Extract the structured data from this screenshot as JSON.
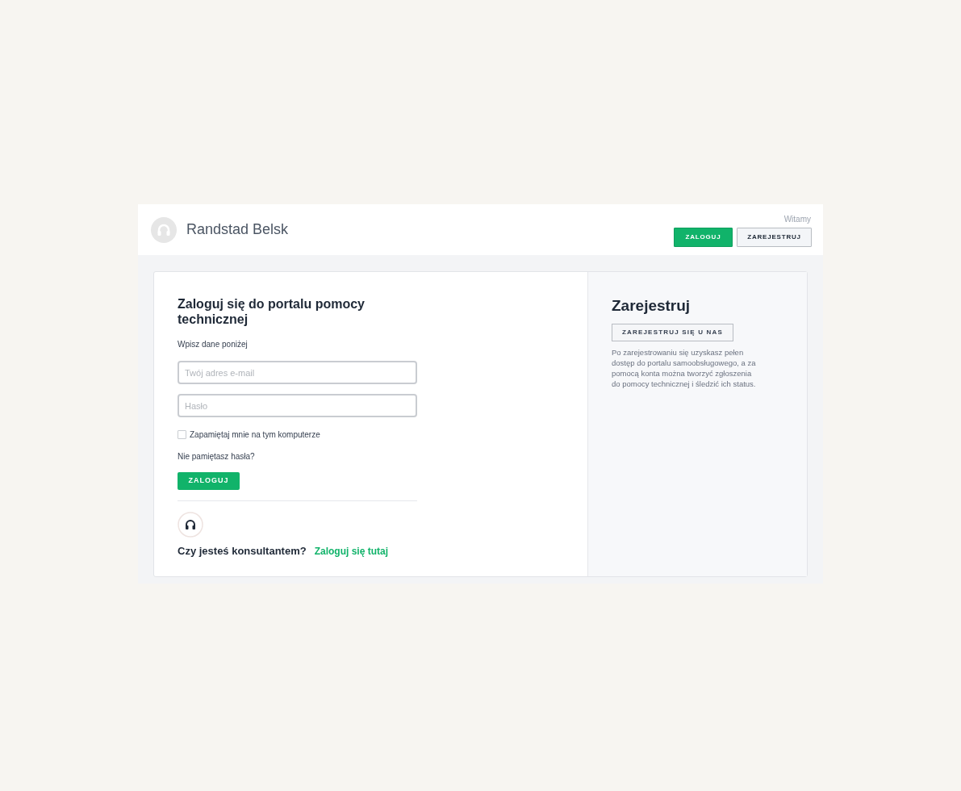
{
  "header": {
    "brand": "Randstad Belsk",
    "greeting": "Witamy",
    "buttons": [
      {
        "label": "ZALOGUJ",
        "kind": "primary"
      },
      {
        "label": "ZAREJESTRUJ",
        "kind": "secondary"
      }
    ]
  },
  "login": {
    "title": "Zaloguj się do portalu pomocy technicznej",
    "subtitle": "Wpisz dane poniżej",
    "fields": [
      {
        "placeholder": "Twój adres e-mail"
      },
      {
        "placeholder": "Hasło"
      }
    ],
    "remember": {
      "label": "Zapamiętaj mnie na tym komputerze",
      "checked": false
    },
    "forgot": "Nie pamiętasz hasła?",
    "submit": "ZALOGUJ",
    "agent_question": "Czy jesteś konsultantem?",
    "agent_link": "Zaloguj się tutaj"
  },
  "register": {
    "title": "Zarejestruj",
    "button": "ZAREJESTRUJ SIĘ U NAS",
    "description": "Po zarejestrowaniu się uzyskasz pełen dostęp do portalu samoobsługowego, a za pomocą konta można tworzyć zgłoszenia do pomocy technicznej i śledzić ich status."
  }
}
